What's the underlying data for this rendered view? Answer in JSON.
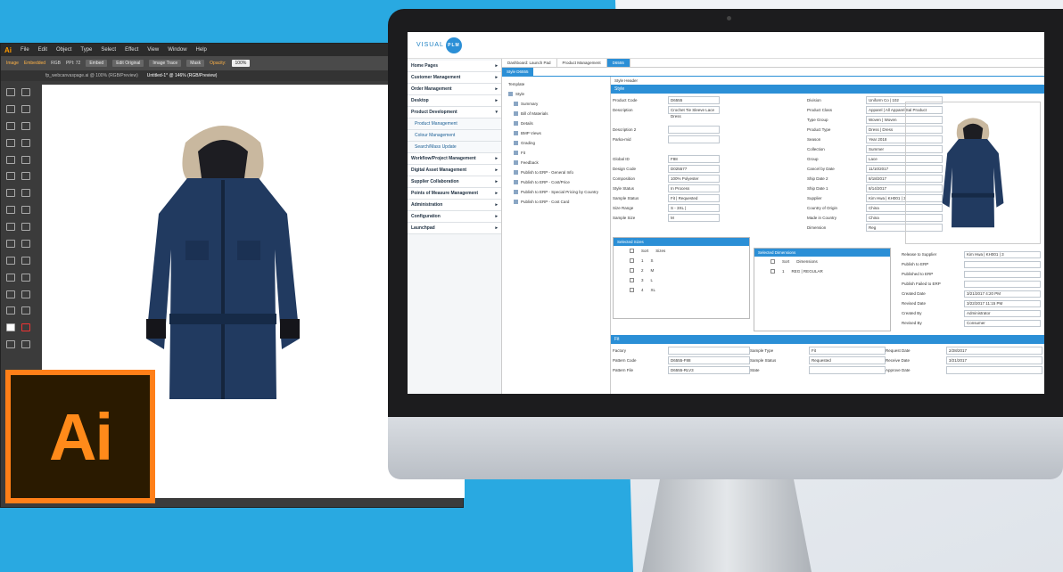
{
  "illustrator": {
    "logo": "Ai",
    "menus": [
      "File",
      "Edit",
      "Object",
      "Type",
      "Select",
      "Effect",
      "View",
      "Window",
      "Help"
    ],
    "control": [
      "Image",
      "Embedded",
      "RGB",
      "PPI: 72",
      "Embed",
      "Edit Original",
      "Image Trace",
      "Mask",
      "Opacity:",
      "100%"
    ],
    "tabs": [
      "fp_webcanvaspage.ai @ 100% (RGB/Preview)",
      "Untitled-1* @ 146% (RGB/Preview)"
    ],
    "badge": "Ai"
  },
  "app": {
    "logo_left": "VISUAL",
    "logo_circle": "PLM",
    "nav": [
      {
        "label": "Home Pages",
        "sub": false
      },
      {
        "label": "Customer Management",
        "sub": false
      },
      {
        "label": "Order Management",
        "sub": false
      },
      {
        "label": "Desktop",
        "sub": false
      },
      {
        "label": "Product Development",
        "sub": false
      },
      {
        "label": "Product Management",
        "sub": true
      },
      {
        "label": "Colour Management",
        "sub": true
      },
      {
        "label": "Search/Mass Update",
        "sub": true
      },
      {
        "label": "Workflow/Project Management",
        "sub": false
      },
      {
        "label": "Digital Asset Management",
        "sub": false
      },
      {
        "label": "Supplier Collaboration",
        "sub": false
      },
      {
        "label": "Points of Measure Management",
        "sub": false
      },
      {
        "label": "Administration",
        "sub": false
      },
      {
        "label": "Configuration",
        "sub": false
      },
      {
        "label": "Launchpad",
        "sub": false
      }
    ],
    "crumbs": [
      "Dashboard: Launch Pad",
      "Product Management",
      "D6555"
    ],
    "subtab": "Style D6555",
    "tree_title": "Template",
    "tree": [
      "Style",
      "Summary",
      "Bill of Materials",
      "Details",
      "BMP Views",
      "Grading",
      "Fit",
      "Feedback",
      "Publish to ERP - General Info",
      "Publish to ERP - Cost/Price",
      "Publish to ERP - Special Pricing by Country",
      "Publish to ERP - Cost Card"
    ],
    "style_header": "Style Header",
    "section_style": "Style",
    "fields": [
      [
        "Product Code",
        "D6555",
        "Division",
        "Uniform Co | 102"
      ],
      [
        "Description",
        "Crochet Tie Sleeve Lace Dress",
        "Product Class",
        "Apparel | All Apparel Sal Product"
      ],
      [
        "",
        "",
        "Type Group",
        "Woven | Woven"
      ],
      [
        "Description 2",
        "",
        "Product Type",
        "Dress | Dress"
      ],
      [
        "Parka-mid",
        "",
        "Season",
        "Year 2018"
      ],
      [
        "",
        "",
        "Collection",
        "Summer"
      ],
      [
        "Global ID",
        "F88",
        "Group",
        "Lace"
      ],
      [
        "Design Code",
        "D025577",
        "Cancel by Date",
        "11/10/2017"
      ],
      [
        "Composition",
        "100% Polyester",
        "Ship Date 2",
        "8/18/2017"
      ],
      [
        "Style Status",
        "In Process",
        "Ship Date 1",
        "8/14/2017"
      ],
      [
        "Sample Status",
        "Fit | Requested",
        "Supplier",
        "Kim Hwa | KH001 | 3"
      ],
      [
        "Size Range",
        "S - 3XL |",
        "Country of Origin",
        "China"
      ],
      [
        "Sample Size",
        "M",
        "Made in Country",
        "China"
      ],
      [
        "",
        "",
        "Dimension",
        "Reg"
      ]
    ],
    "sizes_title": "Selected Sizes",
    "sizes_head": [
      "Sort",
      "Sizes"
    ],
    "sizes": [
      [
        "1",
        "S"
      ],
      [
        "2",
        "M"
      ],
      [
        "3",
        "L"
      ],
      [
        "4",
        "XL"
      ]
    ],
    "dims_title": "Selected Dimensions",
    "dims_head": [
      "Sort",
      "Dimensions"
    ],
    "dims": [
      [
        "1",
        "REG | REGULAR"
      ]
    ],
    "right_fields": [
      [
        "Release to Supplier",
        "Kim Hwa | KH001 | 3"
      ],
      [
        "Publish to ERP",
        ""
      ],
      [
        "Published to ERP",
        ""
      ],
      [
        "Publish Failed to ERP",
        ""
      ],
      [
        "Created Date",
        "3/21/2017 4:20 PM"
      ],
      [
        "Revised Date",
        "3/22/2017 11:15 PM"
      ],
      [
        "Created By",
        "Administrator"
      ],
      [
        "Revised By",
        "Consumer"
      ]
    ],
    "section_fit": "Fit",
    "fit_fields": [
      [
        "Factory",
        "",
        "Sample Type",
        "Fit",
        "Request Date",
        "2/28/2017"
      ],
      [
        "Pattern Code",
        "D6555-F88",
        "Sample Status",
        "Requested",
        "Receive Date",
        "3/21/2017"
      ],
      [
        "Pattern File",
        "D6555-RLV3",
        "State",
        "",
        "Approve Date",
        ""
      ]
    ]
  },
  "colors": {
    "brand": "#2b8fd6",
    "background": "#29a9e1",
    "ai_orange": "#ff7f18"
  }
}
